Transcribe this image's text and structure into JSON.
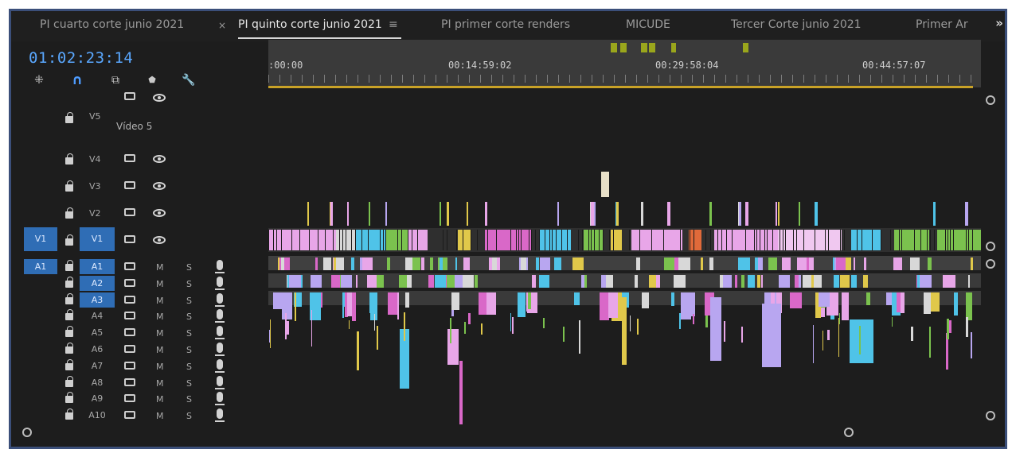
{
  "tabs": [
    {
      "label": "PI cuarto corte junio 2021",
      "active": false
    },
    {
      "label": "PI quinto corte junio 2021",
      "active": true
    },
    {
      "label": "PI primer corte renders",
      "active": false
    },
    {
      "label": "MICUDE",
      "active": false
    },
    {
      "label": "Tercer Corte junio 2021",
      "active": false
    },
    {
      "label": "Primer Ar",
      "active": false
    }
  ],
  "tab_close_glyph": "×",
  "tab_menu_glyph": "≡",
  "overflow_glyph": "»",
  "timecode": "01:02:23:14",
  "tools": [
    {
      "icon": "snap-icon",
      "glyph": "⁜"
    },
    {
      "icon": "magnet-icon",
      "glyph": "∩"
    },
    {
      "icon": "linked-selection-icon",
      "glyph": "⧉"
    },
    {
      "icon": "marker-icon",
      "glyph": "⬟"
    },
    {
      "icon": "wrench-icon",
      "glyph": "🔧"
    }
  ],
  "ruler": {
    "labels": [
      ":00:00",
      "00:14:59:02",
      "00:29:58:04",
      "00:44:57:07"
    ],
    "marker_color": "#9aa61c",
    "workarea_color": "#c9a227"
  },
  "video_tracks": [
    {
      "id": "V5",
      "name": "Vídeo 5",
      "expanded": true
    },
    {
      "id": "V4"
    },
    {
      "id": "V3"
    },
    {
      "id": "V2"
    },
    {
      "id": "V1",
      "source": "V1",
      "targeted": true
    }
  ],
  "audio_tracks": [
    {
      "id": "A1",
      "source": "A1",
      "targeted": true
    },
    {
      "id": "A2",
      "targeted": true
    },
    {
      "id": "A3",
      "targeted": true
    },
    {
      "id": "A4"
    },
    {
      "id": "A5"
    },
    {
      "id": "A6"
    },
    {
      "id": "A7"
    },
    {
      "id": "A8"
    },
    {
      "id": "A9"
    },
    {
      "id": "A10"
    }
  ],
  "mute_label": "M",
  "solo_label": "S",
  "colors": {
    "accent": "#4e9cff",
    "target": "#2f6db5",
    "clip_pink": "#e8a6e8",
    "clip_cyan": "#4fc3e8",
    "clip_green": "#7bc24e",
    "clip_yellow": "#e0c84a",
    "clip_orange": "#e06a3a",
    "clip_magenta": "#d968c8",
    "clip_lavender": "#b8a6f0"
  }
}
